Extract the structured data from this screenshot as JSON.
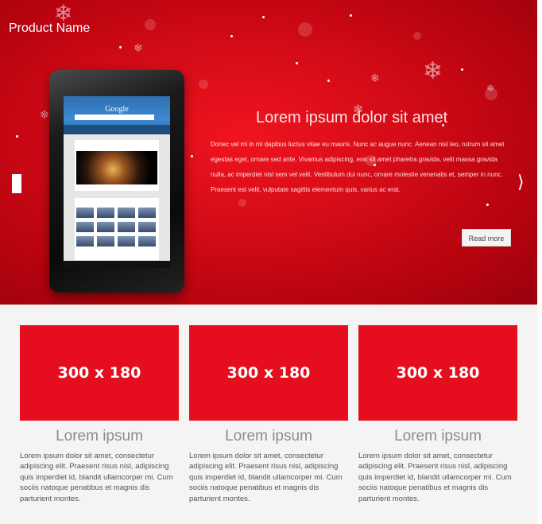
{
  "header": {
    "brand": "Product Name"
  },
  "hero": {
    "title": "Lorem ipsum dolor sit amet",
    "body": "Donec vel mi in mi dapibus luctus vitae eu mauris. Nunc ac augue nunc. Aenean nisl leo, rutrum sit amet egestas eget, ornare sed ante. Vivamus adipiscing, erat sit amet pharetra gravida, velit massa gravida nulla, ac imperdiet nisl sem vel velit. Vestibulum dui nunc, ornare molestie venenatis et, semper in nunc. Praesent est velit, vulputate sagittis elementum quis, varius ac erat.",
    "read_more": "Read more",
    "next_arrow": "⟩",
    "tablet": {
      "logo": "Google"
    }
  },
  "features": [
    {
      "placeholder": "300 x 180",
      "title": "Lorem ipsum",
      "text": "Lorem ipsum dolor sit amet, consectetur adipiscing elit. Praesent risus nisl, adipiscing quis imperdiet id, blandit ullamcorper mi. Cum sociis natoque penatibus et magnis dis parturient montes."
    },
    {
      "placeholder": "300 x 180",
      "title": "Lorem ipsum",
      "text": "Lorem ipsum dolor sit amet, consectetur adipiscing elit. Praesent risus nisl, adipiscing quis imperdiet id, blandit ullamcorper mi. Cum sociis natoque penatibus et magnis dis parturient montes."
    },
    {
      "placeholder": "300 x 180",
      "title": "Lorem ipsum",
      "text": "Lorem ipsum dolor sit amet, consectetur adipiscing elit. Praesent risus nisl, adipiscing quis imperdiet id, blandit ullamcorper mi. Cum sociis natoque penatibus et magnis dis parturient montes."
    }
  ],
  "colors": {
    "hero_red": "#d20b17",
    "placeholder_red": "#e60e1e",
    "footer_bg": "#f4f4f4"
  }
}
